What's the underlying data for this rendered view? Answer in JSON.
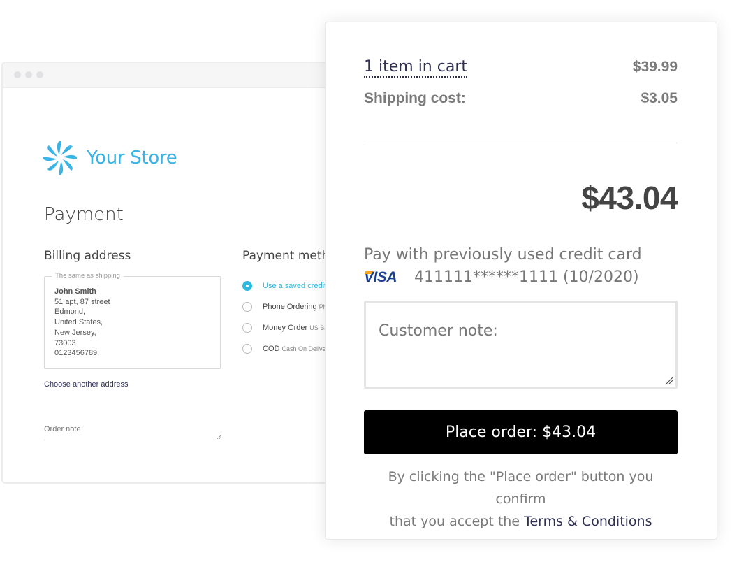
{
  "store": {
    "name": "Your Store",
    "logo_icon": "pinwheel-logo-icon",
    "brand_color": "#3bb4e5"
  },
  "back_page": {
    "title": "Payment",
    "billing": {
      "title": "Billing address",
      "legend": "The same as shipping",
      "name": "John Smith",
      "lines": [
        "51 apt, 87 street",
        "Edmond,",
        "United States,",
        "New Jersey,",
        "73003",
        "0123456789"
      ],
      "choose_link": "Choose another address",
      "order_note_placeholder": "Order note"
    },
    "payment_method": {
      "title": "Payment meth",
      "options": [
        {
          "label": "Use a saved credit",
          "sub": "",
          "checked": true
        },
        {
          "label": "Phone Ordering",
          "sub": "Ph",
          "checked": false
        },
        {
          "label": "Money Order",
          "sub": "US Ba",
          "checked": false
        },
        {
          "label": "COD",
          "sub": "Cash On Deliver",
          "checked": false
        }
      ]
    }
  },
  "summary": {
    "cart_link": "1 item in cart",
    "cart_price": "$39.99",
    "shipping_label": "Shipping cost:",
    "shipping_price": "$3.05",
    "total": "$43.04",
    "pay_with_label": "Pay with previously used credit card",
    "card_brand": "VISA",
    "card_number": "411111******1111 (10/2020)",
    "customer_note_placeholder": "Customer note:",
    "place_order_label": "Place order: $43.04",
    "terms_text_1": "By clicking the \"Place order\" button you confirm",
    "terms_text_2": "that you accept the ",
    "terms_link": "Terms & Conditions"
  }
}
